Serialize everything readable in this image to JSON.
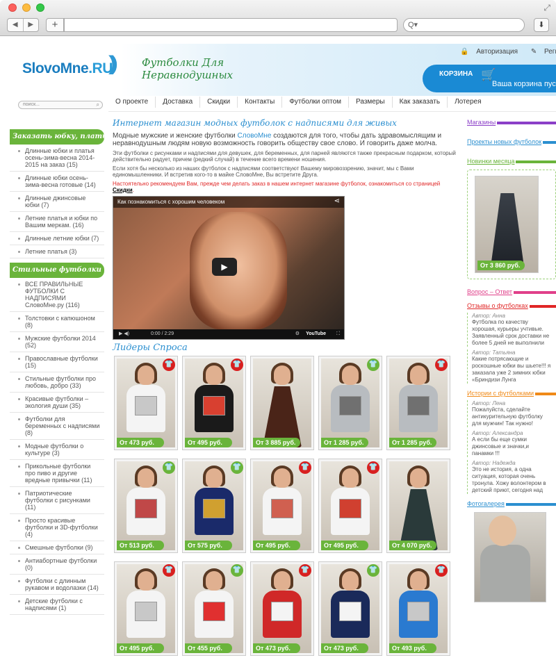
{
  "browser": {
    "search_placeholder": "Q▾"
  },
  "header": {
    "logo_main": "SlovoMne",
    "logo_tld": ".RU",
    "tagline1": "Футболки Для",
    "tagline2": "Неравнодушных",
    "login": "Авторизация",
    "register": "Регистрация",
    "cart_title": "КОРЗИНА",
    "cart_status": "Ваша корзина пуста"
  },
  "search": {
    "placeholder": "поиск..."
  },
  "menu": [
    "О проекте",
    "Доставка",
    "Скидки",
    "Контакты",
    "Футболки оптом",
    "Размеры",
    "Как заказать",
    "Лотерея"
  ],
  "left_sidebar": {
    "section1_title": "Заказать юбку, платье",
    "section1_items": [
      "Длинные юбки и платья осень-зима-весна 2014-2015 на заказ (15)",
      "Длинные юбки осень-зима-весна готовые (14)",
      "Длинные джинсовые юбки (7)",
      "Летние платья и юбки по Вашим меркам. (16)",
      "Длинные летние юбки (7)",
      "Летние платья (3)"
    ],
    "section2_title": "Стильные футболки",
    "section2_items": [
      "ВСЕ ПРАВИЛЬНЫЕ ФУТБОЛКИ С НАДПИСЯМИ СловоМне.ру (116)",
      "Толстовки с капюшоном (8)",
      "Мужские футболки 2014 (52)",
      "Православные футболки (15)",
      "Стильные футболки про любовь, добро (33)",
      "Красивые футболки – экология души (35)",
      "Футболки для беременных с надписями (8)",
      "Модные футболки о культуре (3)",
      "Прикольные футболки про пиво и другие вредные привычки (11)",
      "Патриотические футболки с рисунками (11)",
      "Просто красивые футболки и 3D-футболки (4)",
      "Смешные футболки (9)",
      "Антиабортные футболки (0)",
      "Футболки с длинным рукавом и водолазки (14)",
      "Детские футболки с надписями (1)"
    ]
  },
  "main": {
    "title": "Интернет магазин модных футболок с надписями для живых",
    "intro_before": "Модные мужские и женские футболки ",
    "intro_link": "СловоМне",
    "intro_after": " создаются для того, чтобы дать здравомыслящим и неравнодушным людям новую возможность говорить обществу свое слово. И говорить даже молча.",
    "para2": "Эти футболки с рисунками и надписями для девушек, для беременных, для парней являются также прекрасным подарком, который действительно радует, причем (редкий случай) в течение всего времени ношения.",
    "para3": "Если хотя бы несколько из наших футболок с надписями соответствуют Вашему мировоззрению, значит, мы с Вами единомышленники. И встретив кого-то в майке СловоМне, Вы встретите Друга.",
    "recommend": "Настоятельно рекомендуем Вам, прежде чем делать заказ в нашем интернет магазине футболок, ознакомиться со страницей ",
    "recommend_link": "Скидки",
    "recommend_end": ".",
    "video_title": "Как познакомиться с хорошим человеком",
    "video_time": "0:00 / 2:29",
    "video_brand": "YouTube",
    "leaders_title": "Лидеры Спроса",
    "products": [
      {
        "price": "От  473 руб.",
        "tag": "f",
        "shirt": "#f4f4f4",
        "print": "#c8c8c8"
      },
      {
        "price": "От  495 руб.",
        "tag": "f",
        "shirt": "#1a1a1a",
        "print": "#d84030"
      },
      {
        "price": "От  3 885 руб.",
        "tag": "",
        "shirt": "#4a2418",
        "print": ""
      },
      {
        "price": "От  1 285 руб.",
        "tag": "m",
        "shirt": "#b8bcc0",
        "print": "#707070"
      },
      {
        "price": "От  1 285 руб.",
        "tag": "f",
        "shirt": "#b8bcc0",
        "print": "#707070"
      },
      {
        "price": "От  513 руб.",
        "tag": "m",
        "shirt": "#f4f4f4",
        "print": "#c04848"
      },
      {
        "price": "От  575 руб.",
        "tag": "m",
        "shirt": "#1a2a6a",
        "print": "#d0a030"
      },
      {
        "price": "От  495 руб.",
        "tag": "f",
        "shirt": "#f4f4f4",
        "print": "#d06050"
      },
      {
        "price": "От  495 руб.",
        "tag": "f",
        "shirt": "#f4f4f4",
        "print": "#d04030"
      },
      {
        "price": "От  4 070 руб.",
        "tag": "",
        "shirt": "#2a3a3a",
        "print": ""
      },
      {
        "price": "От  495 руб.",
        "tag": "f",
        "shirt": "#f4f4f4",
        "print": "#c8c8c8"
      },
      {
        "price": "От  455 руб.",
        "tag": "m",
        "shirt": "#f4f4f4",
        "print": "#e03030"
      },
      {
        "price": "От  473 руб.",
        "tag": "f",
        "shirt": "#d02828",
        "print": "#f4f4f4"
      },
      {
        "price": "От  473 руб.",
        "tag": "m",
        "shirt": "#1a2a5a",
        "print": "#f4f4f4"
      },
      {
        "price": "От  493 руб.",
        "tag": "f",
        "shirt": "#2a7ad0",
        "print": "#c8c8c8"
      }
    ]
  },
  "right_sidebar": {
    "links": [
      {
        "label": "Магазины",
        "color": "#8b3fc8"
      },
      {
        "label": "Проекты новых футболок",
        "color": "#2b8fd0"
      },
      {
        "label": "Новинки месяца",
        "color": "#6ab43b"
      }
    ],
    "featured_price": "От  3 860 руб.",
    "qa_link": "Вопрос – Ответ",
    "qa_color": "#e0408a",
    "reviews_link": "Отзывы о футболках",
    "reviews_color": "#e02626",
    "reviews": [
      {
        "author": "Автор: Анна",
        "text": "Футболка по качеству хорошая, курьеры учтивые. Заявленный срок доставки не более 5 дней не выполнили"
      },
      {
        "author": "Автор: Татьяна",
        "text": "Какие потрясающие и роскошные юбки вы шьете!!! я заказала уже 2 зимних юбки «Бриндизи Лунга"
      }
    ],
    "stories_link": "Истории с футболками",
    "stories_color": "#f08a18",
    "stories": [
      {
        "author": "Автор: Лена",
        "text": "Пожалуйста, сделайте антикурительную футболку для мужчин! Так нужно!"
      },
      {
        "author": "Автор: Александра",
        "text": "А если бы еще сумки джинсовые и значки,и панамки !!!"
      },
      {
        "author": "Автор: Надежда",
        "text": "Это не история, а одна ситуация, которая очень тронула. Хожу волонтером в детский приют, сегодня над"
      }
    ],
    "gallery_link": "Фотогалерея",
    "gallery_color": "#2b8fd0"
  }
}
